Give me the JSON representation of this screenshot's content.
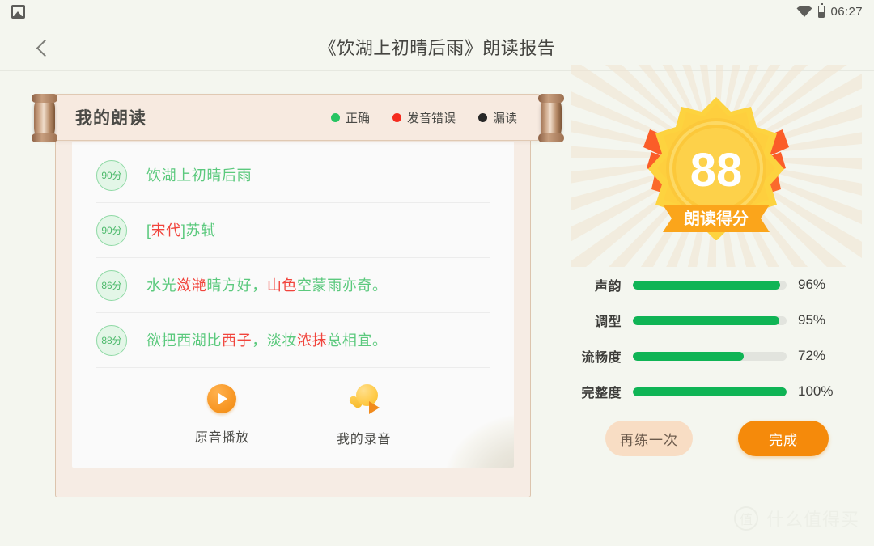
{
  "statusbar": {
    "notification_icon": "image-icon",
    "wifi_icon": "wifi-icon",
    "battery_icon": "battery-icon",
    "time": "06:27"
  },
  "topnav": {
    "back_icon": "chevron-left-icon",
    "title": "《饮湖上初晴后雨》朗读报告"
  },
  "card": {
    "title": "我的朗读",
    "legend": [
      {
        "label": "正确",
        "color": "#27c462"
      },
      {
        "label": "发音错误",
        "color": "#f52b1e"
      },
      {
        "label": "漏读",
        "color": "#272727"
      }
    ],
    "verses": [
      {
        "score": "90分",
        "segments": [
          {
            "text": "饮湖上初晴后雨",
            "state": "correct"
          }
        ]
      },
      {
        "score": "90分",
        "segments": [
          {
            "text": "[",
            "state": "correct"
          },
          {
            "text": "宋代",
            "state": "error"
          },
          {
            "text": "]苏轼",
            "state": "correct"
          }
        ]
      },
      {
        "score": "86分",
        "segments": [
          {
            "text": "水光",
            "state": "correct"
          },
          {
            "text": "潋滟",
            "state": "error"
          },
          {
            "text": "晴方好，",
            "state": "correct"
          },
          {
            "text": "山色",
            "state": "error"
          },
          {
            "text": "空蒙雨亦奇。",
            "state": "correct"
          }
        ]
      },
      {
        "score": "88分",
        "segments": [
          {
            "text": "欲把西湖比",
            "state": "correct"
          },
          {
            "text": "西子",
            "state": "error"
          },
          {
            "text": "，淡妆",
            "state": "correct"
          },
          {
            "text": "浓抹",
            "state": "error"
          },
          {
            "text": "总相宜。",
            "state": "correct"
          }
        ]
      }
    ],
    "audio_actions": [
      {
        "label": "原音播放",
        "icon": "play-circle-icon"
      },
      {
        "label": "我的录音",
        "icon": "microphone-play-icon"
      }
    ]
  },
  "score_badge": {
    "value": "88",
    "caption": "朗读得分",
    "medal_color": "#fdcb3a",
    "ribbon_color": "#f9a61a"
  },
  "metrics": [
    {
      "label": "声韵",
      "value": 96,
      "display": "96%"
    },
    {
      "label": "调型",
      "value": 95,
      "display": "95%"
    },
    {
      "label": "流畅度",
      "value": 72,
      "display": "72%"
    },
    {
      "label": "完整度",
      "value": 100,
      "display": "100%"
    }
  ],
  "buttons": {
    "practice_again": "再练一次",
    "finish": "完成"
  },
  "watermark": {
    "logo": "值",
    "text": "什么值得买"
  },
  "chart_data": {
    "type": "bar",
    "title": "朗读得分维度",
    "categories": [
      "声韵",
      "调型",
      "流畅度",
      "完整度"
    ],
    "values": [
      96,
      95,
      72,
      100
    ],
    "unit": "%",
    "xlabel": "",
    "ylabel": "",
    "ylim": [
      0,
      100
    ],
    "grid": false,
    "legend": "none",
    "bar_color": "#0fb455",
    "track_color": "#e2e4de",
    "orientation": "horizontal"
  }
}
